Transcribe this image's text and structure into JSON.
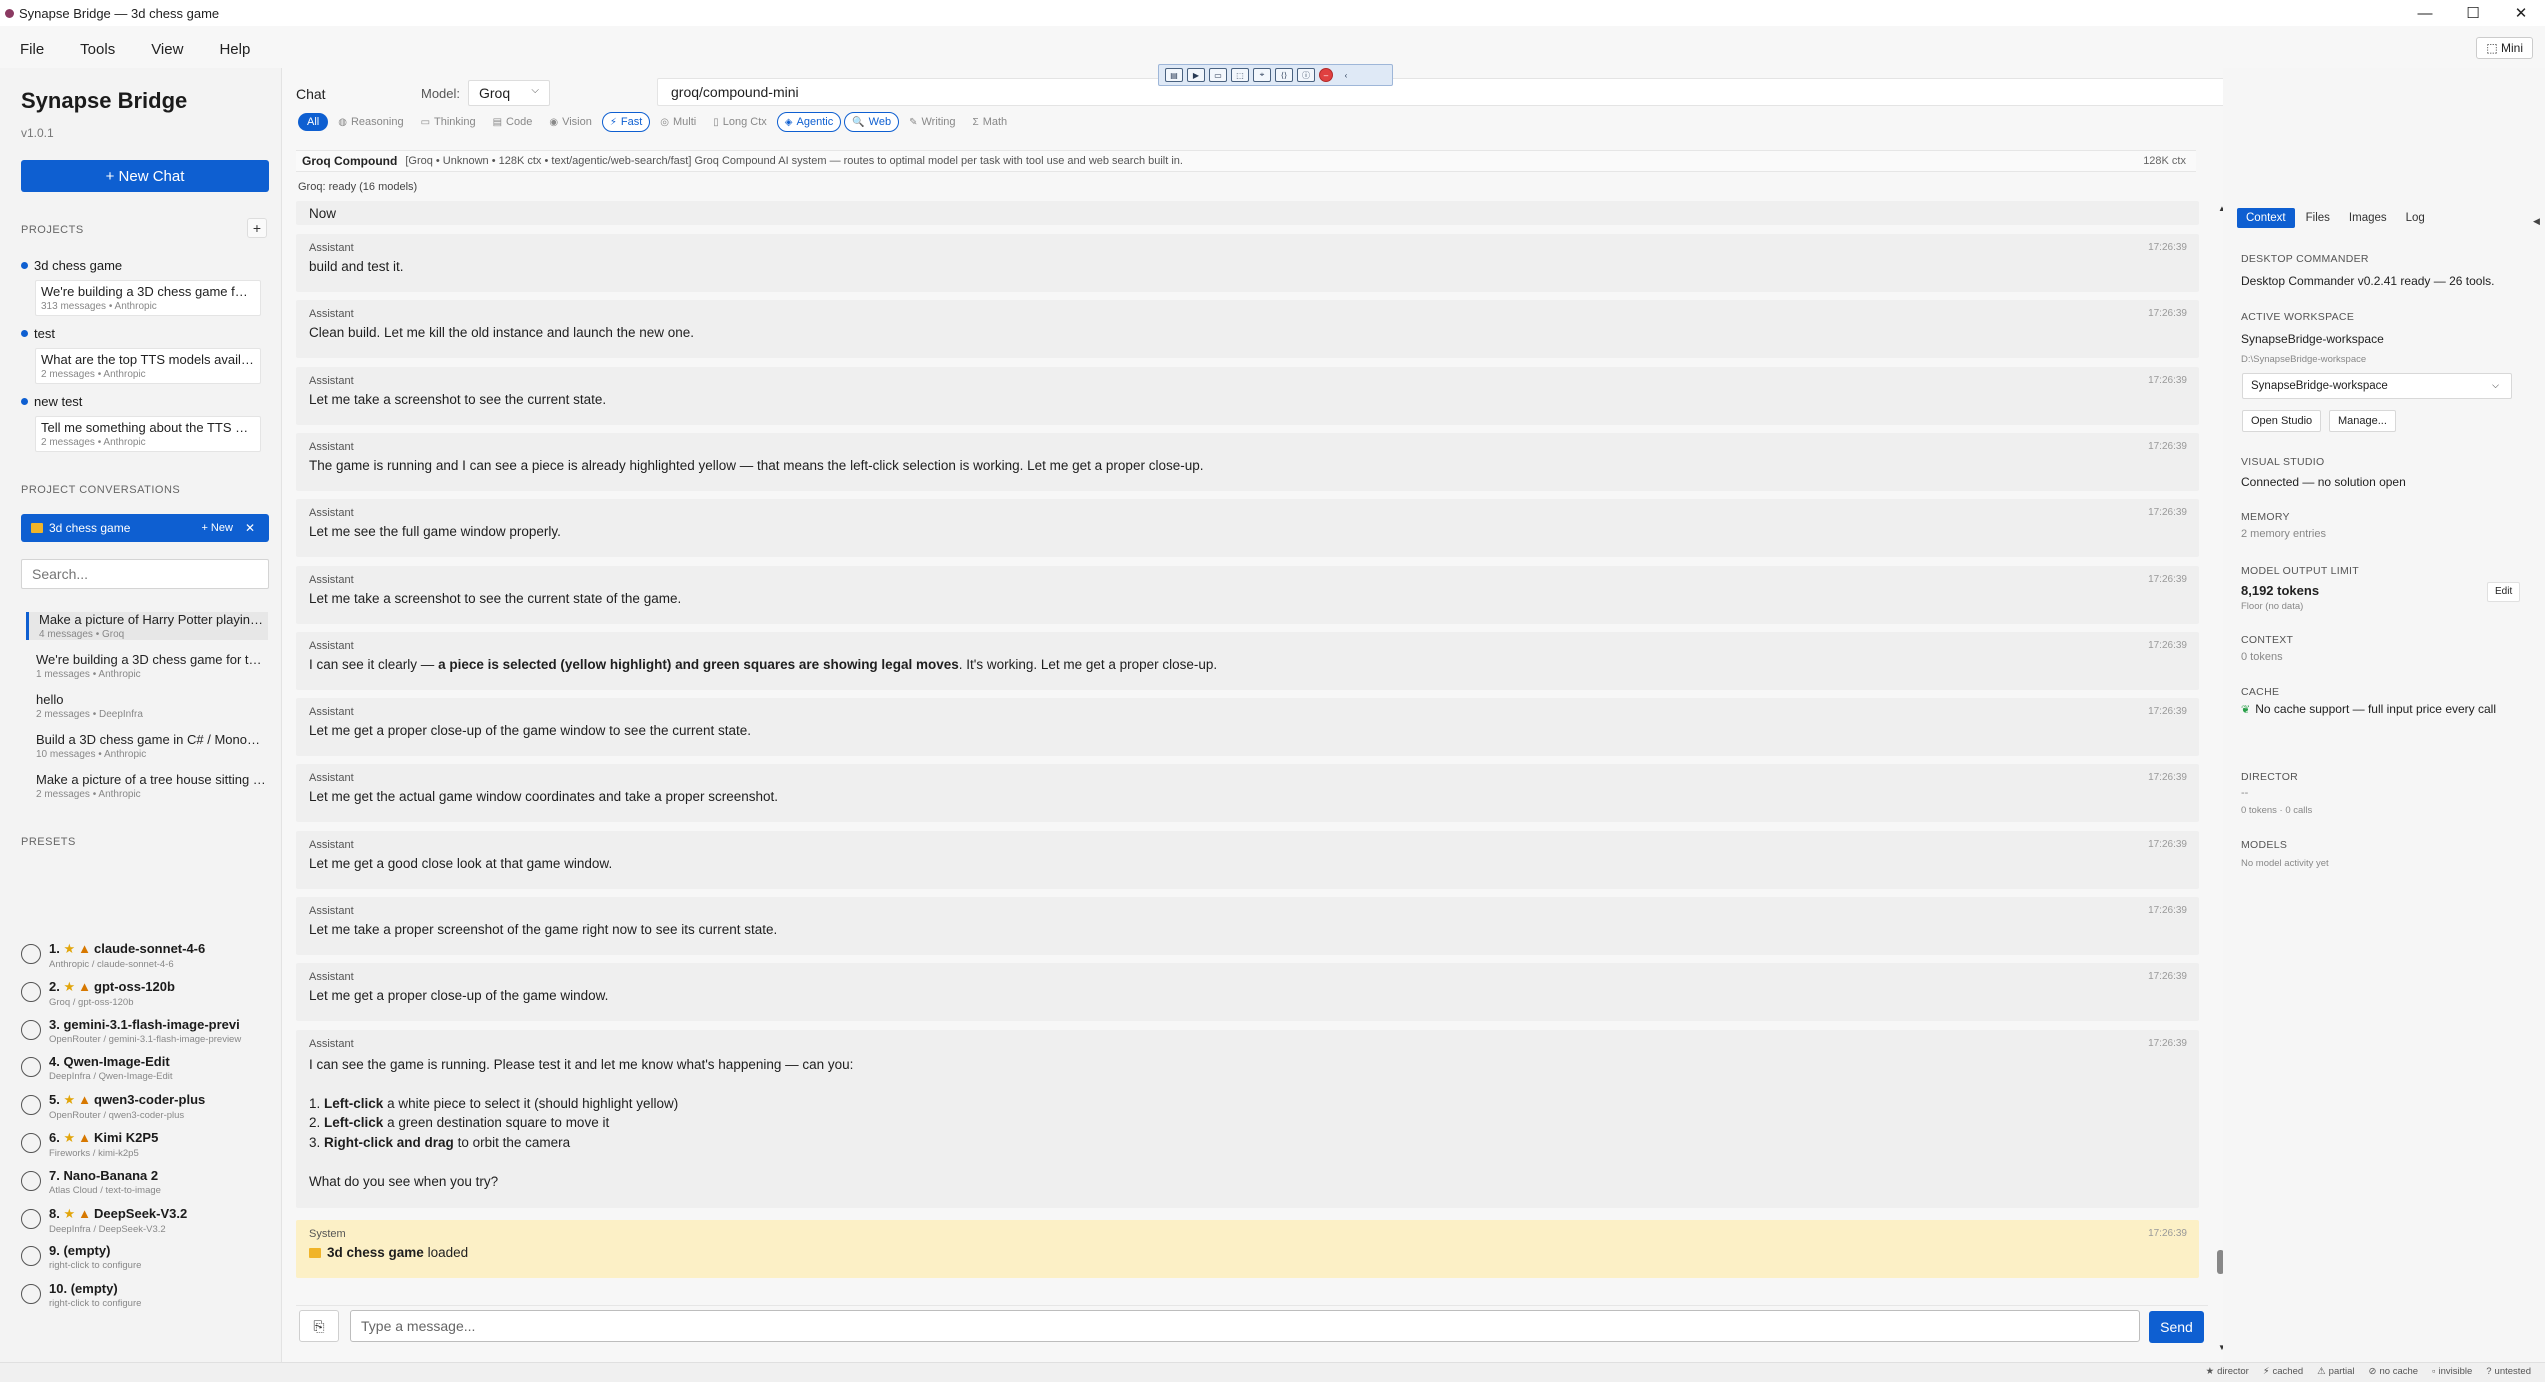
{
  "window": {
    "title": "Synapse Bridge — 3d chess game",
    "minimize": "—",
    "maximize": "☐",
    "close": "✕"
  },
  "menu": [
    "File",
    "Tools",
    "View",
    "Help"
  ],
  "mini_button": "⬚ Mini",
  "sidebar": {
    "app_name": "Synapse Bridge",
    "version": "v1.0.1",
    "new_chat": "+ New Chat",
    "projects_heading": "PROJECTS",
    "add": "+",
    "projects": [
      {
        "name": "3d chess game",
        "chat_title": "We're building a 3D chess game for the...",
        "chat_meta": "313 messages • Anthropic"
      },
      {
        "name": "test",
        "chat_title": "What are the top TTS models available ri...",
        "chat_meta": "2 messages • Anthropic"
      },
      {
        "name": "new test",
        "chat_title": "Tell me something about the TTS model...",
        "chat_meta": "2 messages • Anthropic"
      }
    ],
    "project_conversations_heading": "PROJECT CONVERSATIONS",
    "active_project": {
      "name": "3d chess game",
      "new": "+ New",
      "close": "✕"
    },
    "search_placeholder": "Search...",
    "conversations": [
      {
        "title": "Make a picture of Harry Potter playing...",
        "meta": "4 messages • Groq"
      },
      {
        "title": "We're building a 3D chess game for the...",
        "meta": "1 messages • Anthropic"
      },
      {
        "title": "hello",
        "meta": "2 messages • DeepInfra"
      },
      {
        "title": "Build a 3D chess game in C# / MonoGa...",
        "meta": "10 messages • Anthropic"
      },
      {
        "title": "Make a picture of a tree house sitting in...",
        "meta": "2 messages • Anthropic"
      }
    ],
    "presets_heading": "PRESETS",
    "presets": [
      {
        "label": "1.",
        "name": "claude-sonnet-4-6",
        "star": true,
        "warn": true,
        "meta": "Anthropic / claude-sonnet-4-6"
      },
      {
        "label": "2.",
        "name": "gpt-oss-120b",
        "star": true,
        "warn": true,
        "meta": "Groq / gpt-oss-120b"
      },
      {
        "label": "3.",
        "name": "gemini-3.1-flash-image-previ",
        "star": false,
        "warn": false,
        "meta": "OpenRouter / gemini-3.1-flash-image-preview"
      },
      {
        "label": "4.",
        "name": "Qwen-Image-Edit",
        "star": false,
        "warn": false,
        "meta": "DeepInfra / Qwen-Image-Edit"
      },
      {
        "label": "5.",
        "name": "qwen3-coder-plus",
        "star": true,
        "warn": true,
        "meta": "OpenRouter / qwen3-coder-plus"
      },
      {
        "label": "6.",
        "name": "Kimi K2P5",
        "star": true,
        "warn": true,
        "meta": "Fireworks / kimi-k2p5"
      },
      {
        "label": "7.",
        "name": "Nano-Banana 2",
        "star": false,
        "warn": false,
        "meta": "Atlas Cloud / text-to-image"
      },
      {
        "label": "8.",
        "name": "DeepSeek-V3.2",
        "star": true,
        "warn": true,
        "meta": "DeepInfra / DeepSeek-V3.2"
      },
      {
        "label": "9.",
        "name": "(empty)",
        "star": false,
        "warn": false,
        "meta": "right-click to configure"
      },
      {
        "label": "10.",
        "name": "(empty)",
        "star": false,
        "warn": false,
        "meta": "right-click to configure"
      }
    ]
  },
  "main": {
    "chat_label": "Chat",
    "model_label": "Model:",
    "provider": "Groq",
    "model": "groq/compound-mini",
    "filters": [
      {
        "label": "All",
        "icon": "",
        "state": "all"
      },
      {
        "label": "Reasoning",
        "icon": "◍",
        "state": "off"
      },
      {
        "label": "Thinking",
        "icon": "▭",
        "state": "off"
      },
      {
        "label": "Code",
        "icon": "▤",
        "state": "off"
      },
      {
        "label": "Vision",
        "icon": "◉",
        "state": "off"
      },
      {
        "label": "Fast",
        "icon": "⚡",
        "state": "on"
      },
      {
        "label": "Multi",
        "icon": "◎",
        "state": "off"
      },
      {
        "label": "Long Ctx",
        "icon": "▯",
        "state": "off"
      },
      {
        "label": "Agentic",
        "icon": "◈",
        "state": "on"
      },
      {
        "label": "Web",
        "icon": "🔍",
        "state": "on"
      },
      {
        "label": "Writing",
        "icon": "✎",
        "state": "off"
      },
      {
        "label": "Math",
        "icon": "Σ",
        "state": "off"
      }
    ],
    "model_info_name": "Groq Compound",
    "model_info_desc": "[Groq • Unknown • 128K ctx • text/agentic/web-search/fast] Groq Compound AI system — routes to optimal model per task with tool use and web search built in.",
    "model_info_ctx": "128K ctx",
    "ready": "Groq: ready (16 models)",
    "now_label": "Now",
    "messages": [
      {
        "role": "Assistant",
        "time": "17:26:39",
        "text": "build and test it."
      },
      {
        "role": "Assistant",
        "time": "17:26:39",
        "text": "Clean build. Let me kill the old instance and launch the new one."
      },
      {
        "role": "Assistant",
        "time": "17:26:39",
        "text": "Let me take a screenshot to see the current state."
      },
      {
        "role": "Assistant",
        "time": "17:26:39",
        "text": "The game is running and I can see a piece is already highlighted yellow — that means the left-click selection is working. Let me get a proper close-up."
      },
      {
        "role": "Assistant",
        "time": "17:26:39",
        "text": "Let me see the full game window properly."
      },
      {
        "role": "Assistant",
        "time": "17:26:39",
        "text": "Let me take a screenshot to see the current state of the game."
      },
      {
        "role": "Assistant",
        "time": "17:26:39",
        "text_pre": "I can see it clearly — ",
        "text_bold": "a piece is selected (yellow highlight) and green squares are showing legal moves",
        "text_post": ". It's working. Let me get a proper close-up."
      },
      {
        "role": "Assistant",
        "time": "17:26:39",
        "text": "Let me get a proper close-up of the game window to see the current state."
      },
      {
        "role": "Assistant",
        "time": "17:26:39",
        "text": "Let me get the actual game window coordinates and take a proper screenshot."
      },
      {
        "role": "Assistant",
        "time": "17:26:39",
        "text": "Let me get a good close look at that game window."
      },
      {
        "role": "Assistant",
        "time": "17:26:39",
        "text": "Let me take a proper screenshot of the game right now to see its current state."
      },
      {
        "role": "Assistant",
        "time": "17:26:39",
        "text": "Let me get a proper close-up of the game window."
      }
    ],
    "final_message": {
      "role": "Assistant",
      "time": "17:26:39",
      "intro": "I can see the game is running. Please test it and let me know what's happening — can you:",
      "items": [
        {
          "num": "1.",
          "bold": "Left-click",
          "rest": " a white piece to select it (should highlight yellow)"
        },
        {
          "num": "2.",
          "bold": "Left-click",
          "rest": " a green destination square to move it"
        },
        {
          "num": "3.",
          "bold": "Right-click and drag",
          "rest": " to orbit the camera"
        }
      ],
      "outro": "What do you see when you try?"
    },
    "system_message": {
      "role": "System",
      "time": "17:26:39",
      "bold": "3d chess game",
      "rest": " loaded"
    },
    "composer_placeholder": "Type a message...",
    "send": "Send"
  },
  "right_panel": {
    "tabs": [
      "Context",
      "Files",
      "Images",
      "Log"
    ],
    "desktop_commander_h": "DESKTOP COMMANDER",
    "desktop_commander_v": "Desktop Commander v0.2.41 ready — 26 tools.",
    "workspace_h": "ACTIVE WORKSPACE",
    "workspace_name": "SynapseBridge-workspace",
    "workspace_path": "D:\\SynapseBridge-workspace",
    "workspace_select": "SynapseBridge-workspace",
    "open_studio": "Open Studio",
    "manage": "Manage...",
    "visual_studio_h": "VISUAL STUDIO",
    "visual_studio_v": "Connected — no solution open",
    "memory_h": "MEMORY",
    "memory_v": "2 memory entries",
    "output_limit_h": "MODEL OUTPUT LIMIT",
    "output_limit_v": "8,192 tokens",
    "output_limit_sub": "Floor (no data)",
    "edit": "Edit",
    "context_h": "CONTEXT",
    "context_v": "0 tokens",
    "cache_h": "CACHE",
    "cache_v": "No cache support — full input price every call",
    "director_h": "DIRECTOR",
    "director_v": "--",
    "director_sub": "0 tokens · 0 calls",
    "models_h": "MODELS",
    "models_v": "No model activity yet"
  },
  "status_legend": [
    {
      "icon": "★",
      "label": "director"
    },
    {
      "icon": "⚡",
      "label": "cached"
    },
    {
      "icon": "⚠",
      "label": "partial"
    },
    {
      "icon": "⊘",
      "label": "no cache"
    },
    {
      "icon": "▫",
      "label": "invisible"
    },
    {
      "icon": "?",
      "label": "untested"
    }
  ],
  "colors": {
    "accent": "#0e5fd1",
    "system_bg": "#fcf0c6",
    "message_bg": "#efefef"
  }
}
